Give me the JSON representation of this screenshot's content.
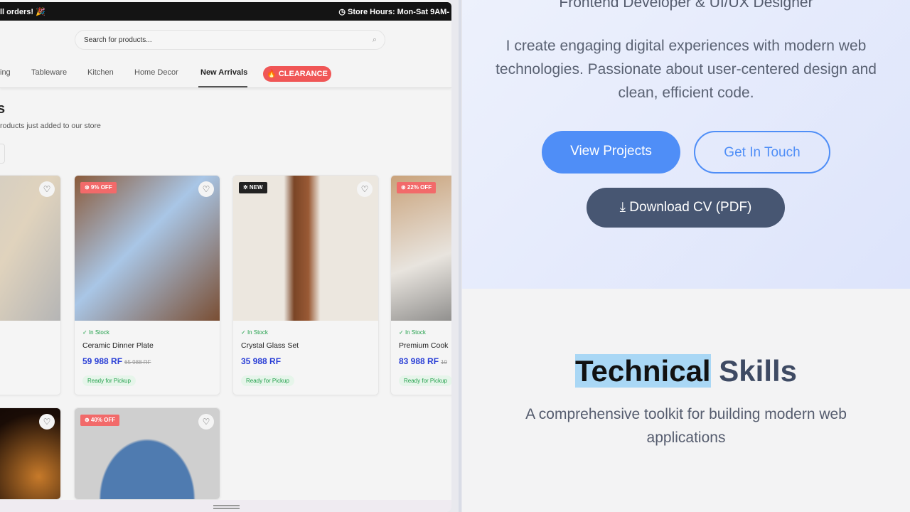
{
  "store": {
    "announcement": "ll orders! 🎉",
    "store_hours": "Store Hours: Mon-Sat 9AM-",
    "search_placeholder": "Search for products...",
    "nav": [
      {
        "label": "ing"
      },
      {
        "label": "Tableware"
      },
      {
        "label": "Kitchen"
      },
      {
        "label": "Home Decor"
      },
      {
        "label": "New Arrivals",
        "active": true
      }
    ],
    "clearance": "🔥 CLEARANCE",
    "section_title": "s",
    "section_subtitle": "roducts just added to our store",
    "products": [
      {
        "badge": "",
        "name": "",
        "price": "",
        "stock": ""
      },
      {
        "badge": "⊛ 9% OFF",
        "name": "Ceramic Dinner Plate",
        "price": "59 988 RF",
        "old_price": "65 988 RF",
        "stock": "In Stock",
        "pickup": "Ready for Pickup"
      },
      {
        "badge": "✲ NEW",
        "name": "Crystal Glass Set",
        "price": "35 988 RF",
        "old_price": "",
        "stock": "In Stock",
        "pickup": "Ready for Pickup"
      },
      {
        "badge": "⊛ 22% OFF",
        "name": "Premium Cook",
        "price": "83 988 RF",
        "old_price": "10",
        "stock": "In Stock",
        "pickup": "Ready for Pickup"
      },
      {
        "badge": "",
        "name": ""
      },
      {
        "badge": "⊛ 40% OFF",
        "name": ""
      }
    ]
  },
  "portfolio": {
    "role": "Frontend Developer & UI/UX Designer",
    "bio": "I create engaging digital experiences with modern web technologies. Passionate about user-centered design and clean, efficient code.",
    "view_projects": "View Projects",
    "get_in_touch": "Get In Touch",
    "download_cv": "Download CV (PDF)",
    "skills_title_highlight": "Technical",
    "skills_title_rest": " Skills",
    "skills_subtitle": "A comprehensive toolkit for building modern web applications"
  },
  "colors": {
    "accent": "#4f8ef7",
    "sale": "#f05656",
    "price": "#2a3fd6",
    "stock": "#22a04b"
  }
}
